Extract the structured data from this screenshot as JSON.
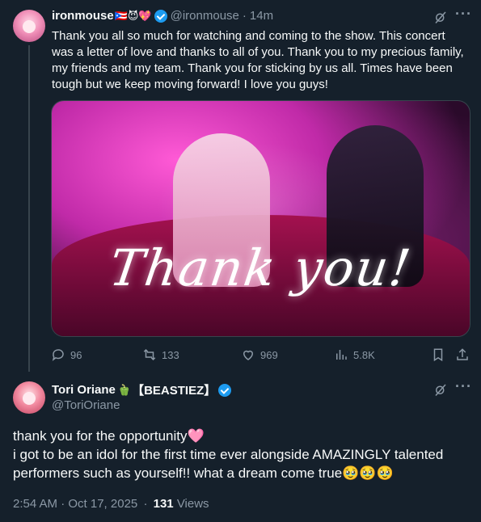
{
  "tweet1": {
    "display_name": "ironmouse",
    "name_emojis": "🇵🇷😈💖",
    "handle": "@ironmouse",
    "separator": "·",
    "time": "14m",
    "text": "Thank you all so much for watching and coming to the show. This concert was a letter of love and thanks to all of you. Thank you to my precious family, my friends and my team. Thank you for sticking by us all. Times have been tough but we keep moving forward! I love you guys!",
    "media_text": "Thank you!",
    "actions": {
      "replies": "96",
      "reposts": "133",
      "likes": "969",
      "views": "5.8K"
    }
  },
  "tweet2": {
    "display_name": "Tori Oriane",
    "name_emoji": "🫑",
    "name_suffix": "【BEASTIEZ】",
    "handle": "@ToriOriane",
    "text_line1": "thank you for the opportunity🩷",
    "text_line2": "i got to be an idol for the first time ever alongside AMAZINGLY talented performers such as yourself!! what a dream come true🥹🥹🥹",
    "timestamp": "2:54 AM · Oct 17, 2025",
    "meta_separator": "·",
    "views_count": "131",
    "views_label": "Views"
  },
  "icons": [
    "grok-icon",
    "more-icon",
    "reply-icon",
    "repost-icon",
    "like-icon",
    "views-icon",
    "bookmark-icon",
    "share-icon",
    "verified-badge-icon"
  ],
  "colors": {
    "background": "#15202b",
    "text": "#f7f9f9",
    "muted": "#8b98a5",
    "verified": "#1d9bf0",
    "divider": "#38444d"
  }
}
